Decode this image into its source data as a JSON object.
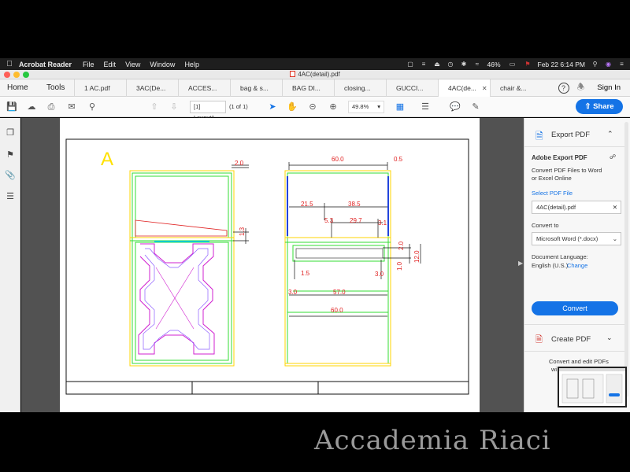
{
  "menubar": {
    "app_name": "Acrobat Reader",
    "items": [
      "File",
      "Edit",
      "View",
      "Window",
      "Help"
    ],
    "battery": "46%",
    "datetime": "Feb 22  6:14 PM"
  },
  "window": {
    "title": "4AC(detail).pdf"
  },
  "tabs": {
    "home": "Home",
    "tools": "Tools",
    "docs": [
      "1 AC.pdf",
      "3AC(De...",
      "ACCES...",
      "bag & s...",
      "BAG DI...",
      "closing...",
      "GUCCI...",
      "4AC(de...",
      "chair &..."
    ],
    "active_index": 7,
    "sign_in": "Sign In"
  },
  "toolbar": {
    "page_label": "[1] Layout1",
    "page_count": "(1 of 1)",
    "zoom": "49.8%",
    "share_label": "Share"
  },
  "drawing": {
    "section_letter": "A",
    "dims": {
      "d2_0": "2.0",
      "d1_3": "1.3",
      "d60_top": "60.0",
      "d0_5": "0.5",
      "d21_5": "21.5",
      "d38_5": "38.5",
      "d5_3": "5.3",
      "d29_7": "29.7",
      "d3_1": "3.1",
      "d2_0b": "2.0",
      "d12_0": "12.0",
      "d1_0": "1.0",
      "d1_5": "1.5",
      "d3_0": "3.0",
      "d3_0b": "3.0",
      "d57_0": "57.0",
      "d60_bottom": "60.0"
    }
  },
  "panel": {
    "export_title": "Export PDF",
    "adobe_export": "Adobe Export PDF",
    "desc_line1": "Convert PDF Files to Word",
    "desc_line2": "or Excel Online",
    "select_label": "Select PDF File",
    "file_name": "4AC(detail).pdf",
    "convert_to_label": "Convert to",
    "format": "Microsoft Word (*.docx)",
    "lang_label": "Document Language:",
    "lang_value": "English (U.S.)",
    "change": "Change",
    "convert_button": "Convert",
    "create_pdf": "Create PDF",
    "promo_line1": "Convert and edit PDFs",
    "promo_line2": "wi"
  },
  "watermark": "Accademia Riaci",
  "colors": {
    "accent": "#1473e6",
    "dim_red": "#e02020",
    "frame_green": "#33dd33",
    "frame_yellow": "#ffd400",
    "pattern_magenta": "#d020d0"
  }
}
